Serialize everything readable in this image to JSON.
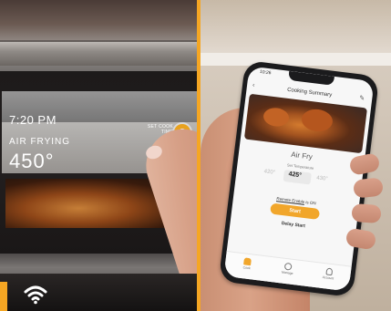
{
  "oven_display": {
    "time": "7:20 PM",
    "mode": "AIR FRYING",
    "temperature": "450°",
    "set_label": "SET COOK TIME"
  },
  "app": {
    "status_time": "10:26",
    "header_title": "Cooking Summary",
    "mode_name": "Air Fry",
    "temp_label": "Set Temperature",
    "temps": [
      "420°",
      "425°",
      "430°"
    ],
    "selected_temp_index": 1,
    "remote_prefix": "Remote Enable",
    "remote_suffix": " is ON",
    "start_label": "Start",
    "delay_label": "Delay Start",
    "nav": [
      "Cook",
      "Manage",
      "Account"
    ]
  },
  "colors": {
    "accent": "#f5a623"
  }
}
